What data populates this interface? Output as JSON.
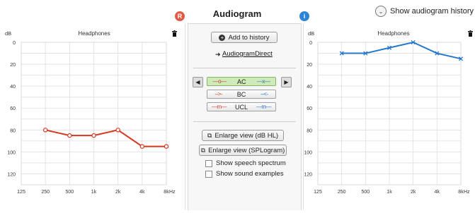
{
  "header": {
    "title": "Audiogram",
    "left_badge": "R",
    "right_badge": "i",
    "history_link": "Show audiogram history"
  },
  "left_chart": {
    "title": "Headphones",
    "unit_label": "dB",
    "x_unit": "Hz"
  },
  "right_chart": {
    "title": "Headphones",
    "unit_label": "dB",
    "x_unit": "Hz"
  },
  "middle": {
    "add_history": "Add to history",
    "direct_link": "AudiogramDirect",
    "symbols": [
      {
        "red": "—o—",
        "label": "AC",
        "blue": "—x—",
        "active": true
      },
      {
        "red": "-->-",
        "label": "BC",
        "blue": "--<-",
        "active": false
      },
      {
        "red": "—m—",
        "label": "UCL",
        "blue": "—m—",
        "active": false
      }
    ],
    "enlarge_hl": "Enlarge view (dB HL)",
    "enlarge_spl": "Enlarge view (SPLogram)",
    "show_speech": "Show speech spectrum",
    "show_sound": "Show sound examples"
  },
  "colors": {
    "left_series": "#d7361f",
    "right_series": "#2478cc",
    "grid": "#dedede",
    "active_symbol": "#cfe9b8"
  },
  "chart_data": [
    {
      "type": "line",
      "title": "Headphones",
      "ylabel": "dB",
      "xlabel": "Hz",
      "x": [
        "125",
        "250",
        "500",
        "1k",
        "2k",
        "4k",
        "8k"
      ],
      "yticks": [
        0,
        20,
        40,
        60,
        80,
        100,
        120
      ],
      "ylim": [
        0,
        130
      ],
      "y_inverted": true,
      "grid": true,
      "series": [
        {
          "values": [
            null,
            80,
            85,
            85,
            80,
            95,
            95
          ],
          "color": "#d7361f",
          "marker": "circle"
        }
      ]
    },
    {
      "type": "line",
      "title": "Headphones",
      "ylabel": "dB",
      "xlabel": "Hz",
      "x": [
        "125",
        "250",
        "500",
        "1k",
        "2k",
        "4k",
        "8k"
      ],
      "yticks": [
        0,
        20,
        40,
        60,
        80,
        100,
        120
      ],
      "ylim": [
        0,
        130
      ],
      "y_inverted": true,
      "grid": true,
      "series": [
        {
          "values": [
            null,
            10,
            10,
            5,
            0,
            10,
            15
          ],
          "color": "#2478cc",
          "marker": "x"
        }
      ]
    }
  ]
}
